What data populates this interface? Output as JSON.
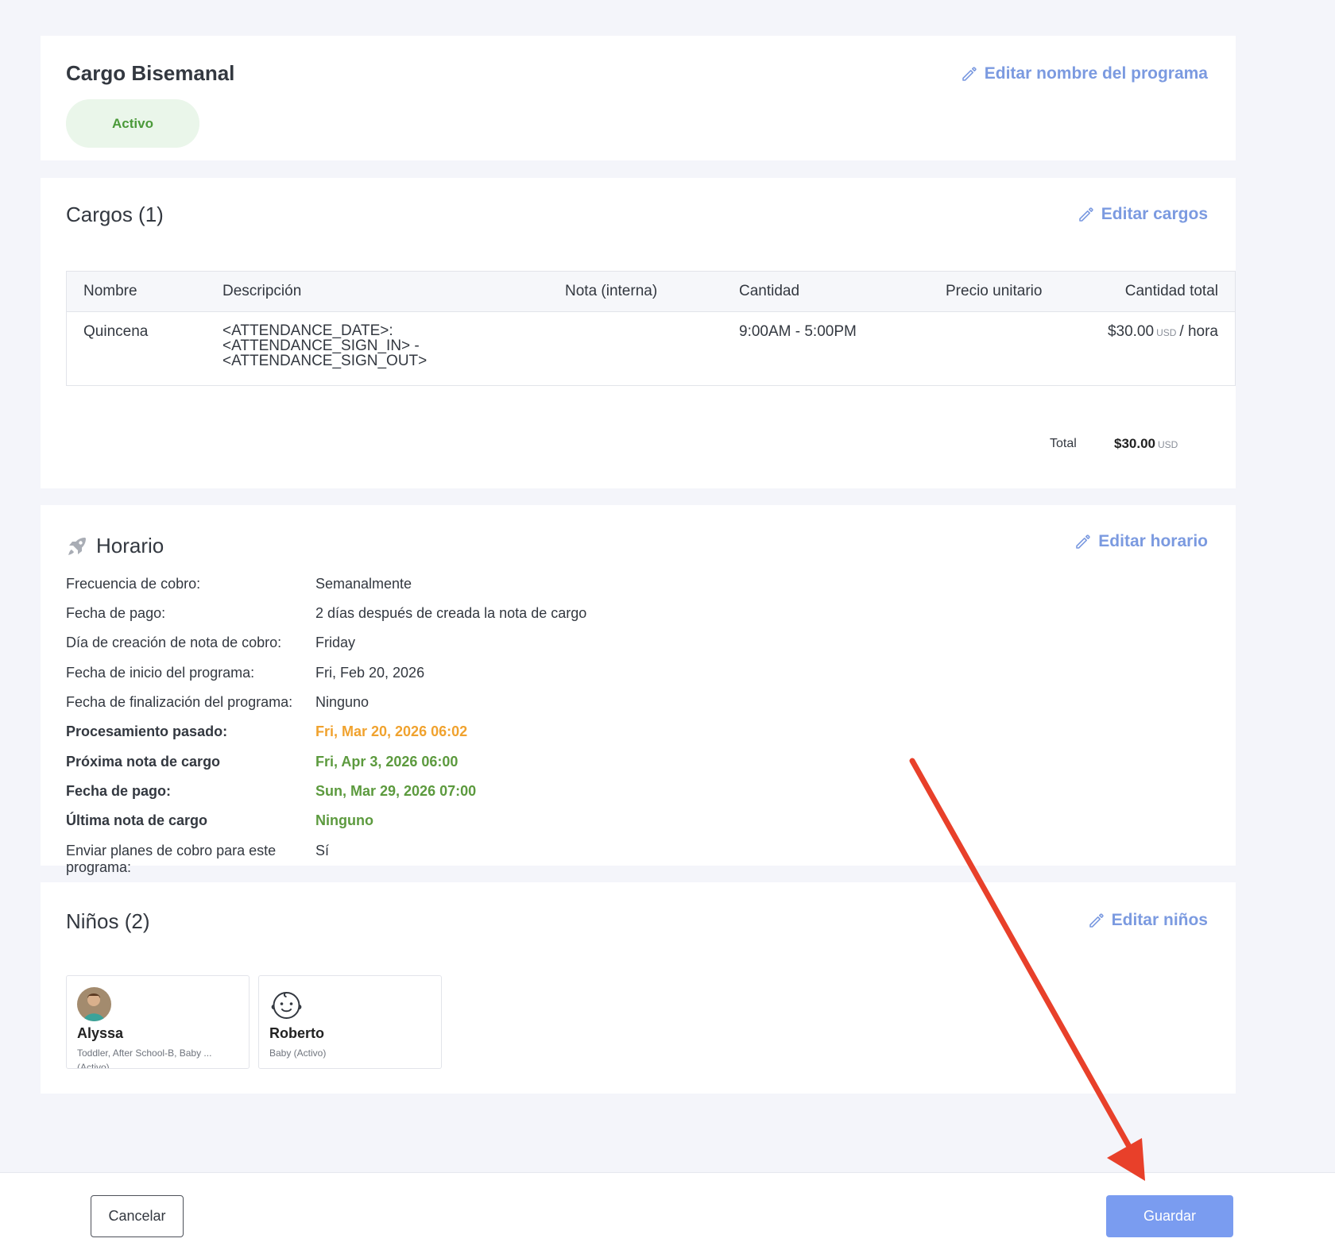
{
  "program": {
    "title": "Cargo Bisemanal",
    "status": "Activo",
    "edit_label": "Editar nombre del programa"
  },
  "charges": {
    "title": "Cargos (1)",
    "edit_label": "Editar cargos",
    "columns": [
      "Nombre",
      "Descripción",
      "Nota (interna)",
      "Cantidad",
      "Precio unitario",
      "Cantidad total"
    ],
    "rows": [
      {
        "name": "Quincena",
        "description_lines": [
          "<ATTENDANCE_DATE>:",
          "<ATTENDANCE_SIGN_IN> -",
          "<ATTENDANCE_SIGN_OUT>"
        ],
        "note": "",
        "quantity": "9:00AM - 5:00PM",
        "unit_price": "",
        "total_amount": "$30.00",
        "total_currency": "USD",
        "total_unit": "/ hora"
      }
    ],
    "total_label": "Total",
    "total_amount": "$30.00",
    "total_currency": "USD"
  },
  "schedule": {
    "title": "Horario",
    "edit_label": "Editar horario",
    "rows": [
      {
        "label": "Frecuencia de cobro:",
        "value": "Semanalmente"
      },
      {
        "label": "Fecha de pago:",
        "value": "2 días después de creada la nota de cargo"
      },
      {
        "label": "Día de creación de nota de cobro:",
        "value": "Friday"
      },
      {
        "label": "Fecha de inicio del programa:",
        "value": "Fri, Feb 20, 2026"
      },
      {
        "label": "Fecha de finalización del programa:",
        "value": "Ninguno"
      },
      {
        "label": "Procesamiento pasado:",
        "value": "Fri, Mar 20, 2026 06:02"
      },
      {
        "label": "Próxima nota de cargo",
        "value": "Fri, Apr 3, 2026 06:00"
      },
      {
        "label": "Fecha de pago:",
        "value": "Sun, Mar 29, 2026 07:00"
      },
      {
        "label": "Última nota de cargo",
        "value": "Ninguno"
      },
      {
        "label": "Enviar planes de cobro para este programa:",
        "value": "Sí"
      }
    ]
  },
  "children": {
    "title": "Niños (2)",
    "edit_label": "Editar niños",
    "items": [
      {
        "name": "Alyssa",
        "groups": "Toddler, After School-B, Baby ... (Activo)"
      },
      {
        "name": "Roberto",
        "groups": "Baby (Activo)"
      }
    ]
  },
  "footer": {
    "cancel_label": "Cancelar",
    "save_label": "Guardar"
  },
  "colors": {
    "accent": "#7a9cf0",
    "link": "#7b9ae0",
    "status_green": "#4b9a3a",
    "orange": "#f0a22e",
    "green": "#5c9a3e",
    "annotation_arrow": "#e8402a"
  }
}
